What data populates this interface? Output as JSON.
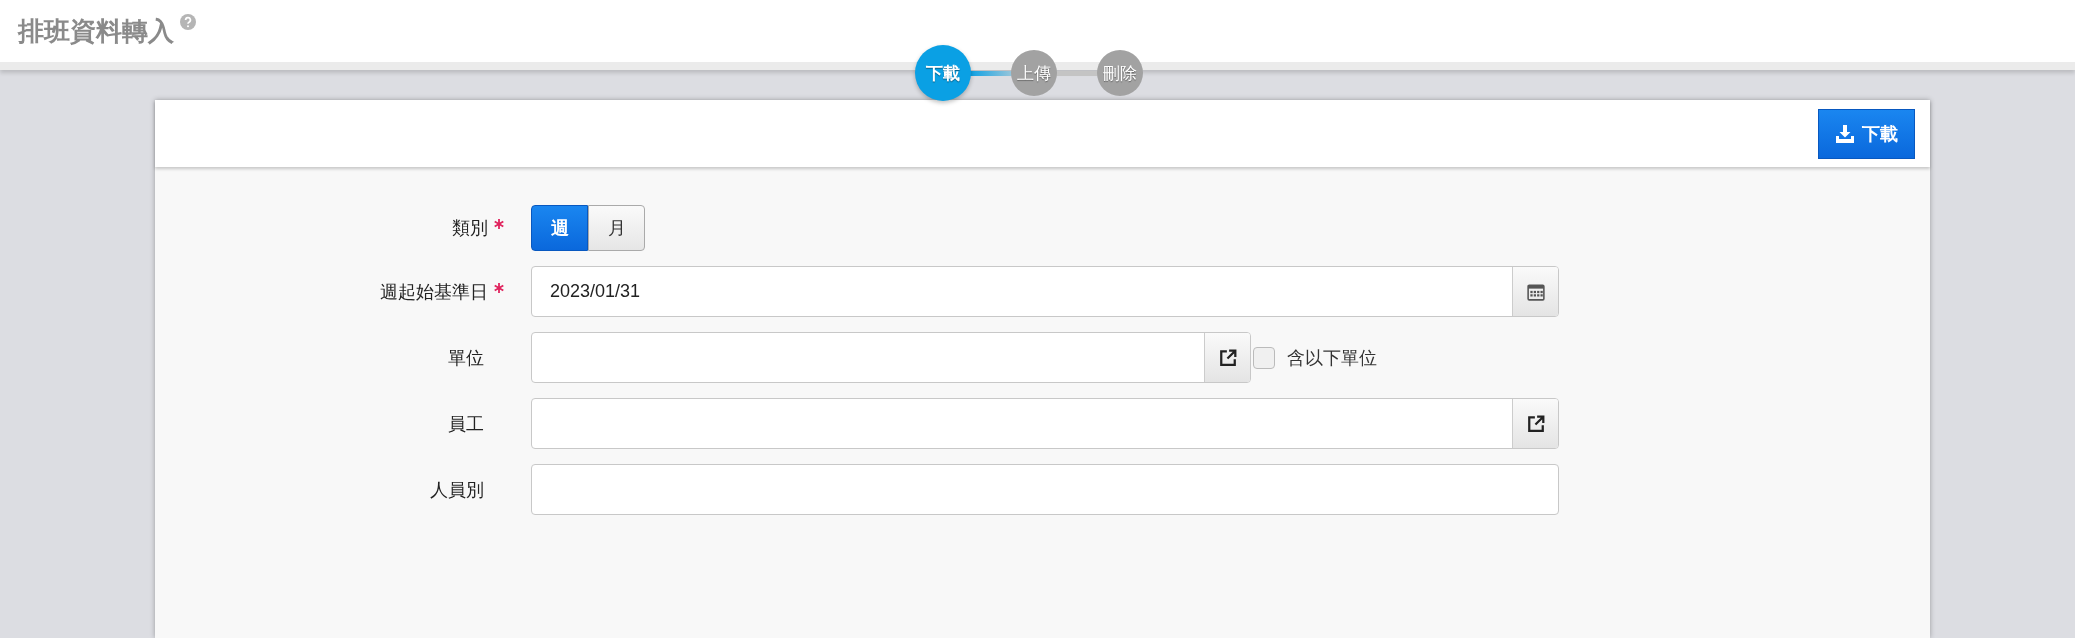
{
  "page": {
    "title": "排班資料轉入"
  },
  "steps": [
    {
      "label": "下載",
      "selected": true
    },
    {
      "label": "上傳",
      "selected": false
    },
    {
      "label": "刪除",
      "selected": false
    }
  ],
  "toolbar": {
    "buttons": [
      {
        "label": "下載"
      }
    ]
  },
  "form": {
    "fields": [
      {
        "kind": "toggle",
        "label": "類別",
        "required": true,
        "options": [
          {
            "label": "週",
            "selected": true
          },
          {
            "label": "月",
            "selected": false
          }
        ]
      },
      {
        "kind": "date",
        "label": "週起始基準日",
        "required": true,
        "value": "2023/01/31"
      },
      {
        "kind": "picker",
        "label": "單位",
        "required": false,
        "checkbox": {
          "label": "含以下單位",
          "checked": false
        }
      },
      {
        "kind": "picker",
        "label": "員工",
        "required": false
      },
      {
        "kind": "text",
        "label": "人員別",
        "required": false
      }
    ]
  }
}
